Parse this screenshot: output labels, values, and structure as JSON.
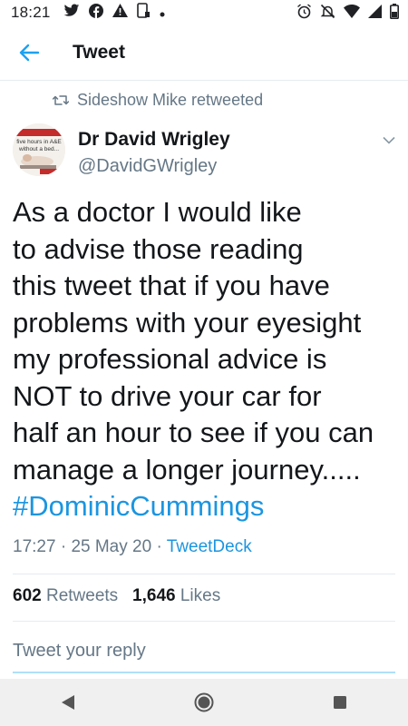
{
  "status_bar": {
    "time": "18:21",
    "icons_left": [
      "twitter-icon",
      "facebook-icon",
      "alert-icon",
      "screenshot-icon",
      "dot-icon"
    ],
    "icons_right": [
      "alarm-icon",
      "mute-icon",
      "wifi-icon",
      "signal-icon",
      "battery-icon"
    ]
  },
  "header": {
    "title": "Tweet"
  },
  "retweet": {
    "label": "Sideshow Mike retweeted"
  },
  "author": {
    "name": "Dr David Wrigley",
    "handle": "@DavidGWrigley"
  },
  "tweet": {
    "lines": [
      "As a doctor I would like",
      "to advise those reading",
      "this tweet that if you have",
      "problems with your eyesight",
      "my professional advice is",
      "NOT to drive your car for",
      "half an hour to see if you can",
      "manage a longer journey....."
    ],
    "hashtag": "#DominicCummings",
    "time": "17:27",
    "date": "25 May 20",
    "source": "TweetDeck",
    "separator": " · "
  },
  "stats": {
    "retweets_count": "602",
    "retweets_label": "Retweets",
    "likes_count": "1,646",
    "likes_label": "Likes"
  },
  "reply": {
    "placeholder": "Tweet your reply"
  },
  "avatar_text": {
    "top": "five hours in A&E",
    "middle": "without a bed..."
  },
  "colors": {
    "accent": "#1da1f2",
    "link": "#1b95e0",
    "secondary_text": "#657786",
    "primary_text": "#14171a"
  }
}
